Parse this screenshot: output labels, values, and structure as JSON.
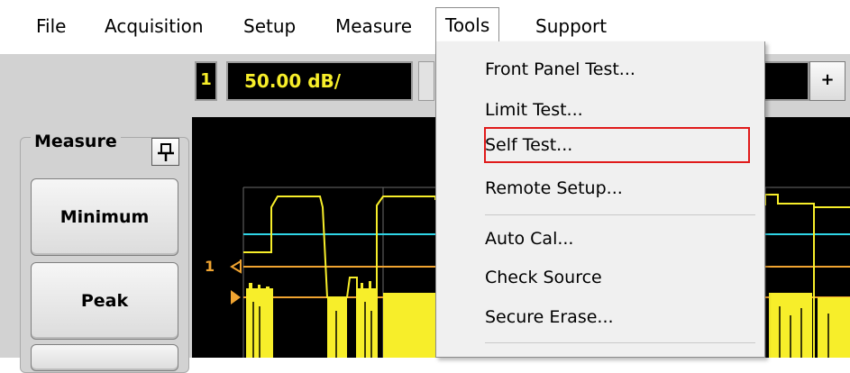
{
  "menubar": {
    "items": [
      "File",
      "Acquisition",
      "Setup",
      "Measure",
      "Tools",
      "Support"
    ],
    "active": "Tools"
  },
  "toolbar": {
    "channel": "1",
    "scale": "50.00 dB/",
    "plus_label": "+"
  },
  "measure_panel": {
    "title": "Measure",
    "buttons": [
      "Minimum",
      "Peak"
    ]
  },
  "graph": {
    "marker_label": "1",
    "colors": {
      "trace": "#f7ee2a",
      "reference": "#2fd4e6",
      "marker": "#f0a431",
      "grid": "#6b6b6b"
    }
  },
  "tools_menu": {
    "items": [
      "Front Panel Test...",
      "Limit Test...",
      "Self Test...",
      "Remote Setup...",
      "Auto Cal...",
      "Check Source",
      "Secure Erase..."
    ],
    "highlighted": "Self Test..."
  }
}
